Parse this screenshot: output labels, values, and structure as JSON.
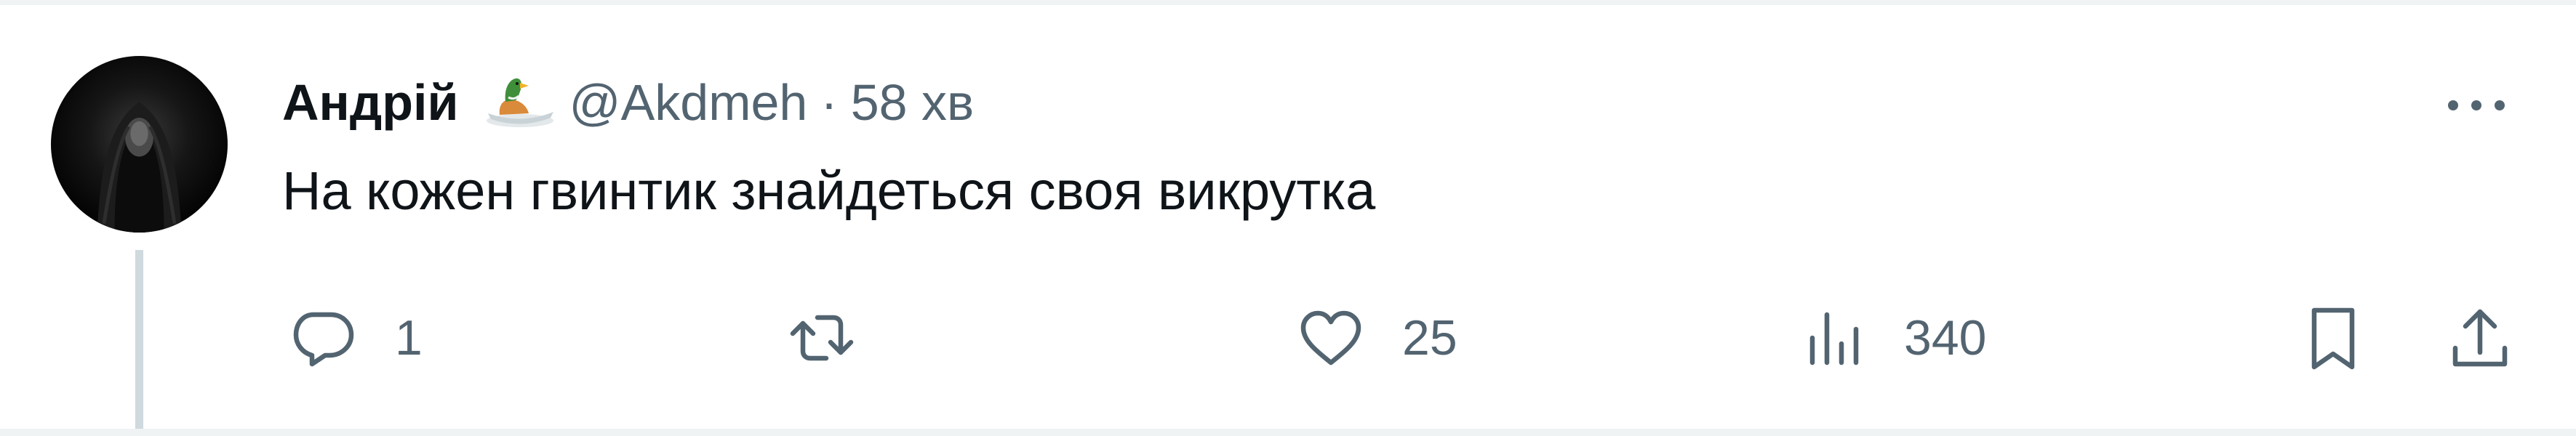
{
  "author": {
    "name": "Андрій",
    "handle": "@Akdmeh",
    "separator": "·",
    "time": "58 хв"
  },
  "tweet": {
    "text": "На кожен гвинтик знайдеться своя викрутка"
  },
  "actions": {
    "reply_count": "1",
    "like_count": "25",
    "views_count": "340"
  },
  "icons": {
    "avatar": "avatar-image",
    "badge": "duck-emoji-badge",
    "more": "more-dots-icon",
    "reply": "reply-icon",
    "retweet": "retweet-icon",
    "like": "heart-icon",
    "views": "views-chart-icon",
    "bookmark": "bookmark-icon",
    "share": "share-icon"
  },
  "colors": {
    "text_primary": "#0f1419",
    "text_secondary": "#536471",
    "divider": "#eff3f4",
    "thread_line": "#cfd9de"
  }
}
